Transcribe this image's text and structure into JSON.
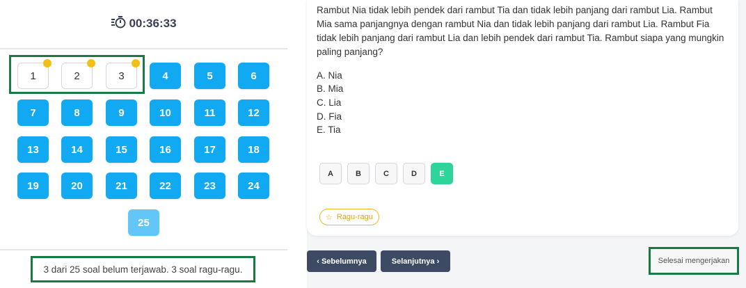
{
  "timer": {
    "icon": "stopwatch-icon",
    "value": "00:36:33"
  },
  "question_nav": {
    "items": [
      {
        "label": "1",
        "state": "answered",
        "flagged": true
      },
      {
        "label": "2",
        "state": "answered",
        "flagged": true
      },
      {
        "label": "3",
        "state": "answered",
        "flagged": true
      },
      {
        "label": "4",
        "state": "unanswered",
        "flagged": false
      },
      {
        "label": "5",
        "state": "unanswered",
        "flagged": false
      },
      {
        "label": "6",
        "state": "unanswered",
        "flagged": false
      },
      {
        "label": "7",
        "state": "unanswered",
        "flagged": false
      },
      {
        "label": "8",
        "state": "unanswered",
        "flagged": false
      },
      {
        "label": "9",
        "state": "unanswered",
        "flagged": false
      },
      {
        "label": "10",
        "state": "unanswered",
        "flagged": false
      },
      {
        "label": "11",
        "state": "unanswered",
        "flagged": false
      },
      {
        "label": "12",
        "state": "unanswered",
        "flagged": false
      },
      {
        "label": "13",
        "state": "unanswered",
        "flagged": false
      },
      {
        "label": "14",
        "state": "unanswered",
        "flagged": false
      },
      {
        "label": "15",
        "state": "unanswered",
        "flagged": false
      },
      {
        "label": "16",
        "state": "unanswered",
        "flagged": false
      },
      {
        "label": "17",
        "state": "unanswered",
        "flagged": false
      },
      {
        "label": "18",
        "state": "unanswered",
        "flagged": false
      },
      {
        "label": "19",
        "state": "unanswered",
        "flagged": false
      },
      {
        "label": "20",
        "state": "unanswered",
        "flagged": false
      },
      {
        "label": "21",
        "state": "unanswered",
        "flagged": false
      },
      {
        "label": "22",
        "state": "unanswered",
        "flagged": false
      },
      {
        "label": "23",
        "state": "unanswered",
        "flagged": false
      },
      {
        "label": "24",
        "state": "unanswered",
        "flagged": false
      },
      {
        "label": "25",
        "state": "current",
        "flagged": false
      }
    ]
  },
  "status_text": "3 dari 25 soal belum terjawab. 3 soal ragu-ragu.",
  "question": {
    "text": "Rambut Nia tidak lebih pendek dari rambut Tia dan tidak lebih panjang dari rambut Lia. Rambut Mia sama panjangnya dengan rambut Nia dan tidak lebih panjang dari rambut Lia. Rambut Fia tidak lebih panjang dari rambut Lia dan lebih pendek dari rambut Tia. Rambut siapa yang mungkin paling panjang?",
    "options": [
      "A. Nia",
      "B. Mia",
      "C. Lia",
      "D. Fia",
      "E. Tia"
    ]
  },
  "answer_buttons": [
    "A",
    "B",
    "C",
    "D",
    "E"
  ],
  "selected_answer": "E",
  "doubt_button": {
    "icon": "star-icon",
    "label": "Ragu-ragu"
  },
  "nav": {
    "prev_label": "‹ Sebelumnya",
    "next_label": "Selanjutnya ›",
    "finish_label": "Selesai mengerjakan"
  },
  "colors": {
    "nav_unanswered": "#10a9f2",
    "nav_current": "#62c7f7",
    "flag_dot": "#f5c016",
    "selected_answer": "#2ed59a",
    "highlight_border": "#1a7a45",
    "nav_button": "#3c4a64"
  }
}
